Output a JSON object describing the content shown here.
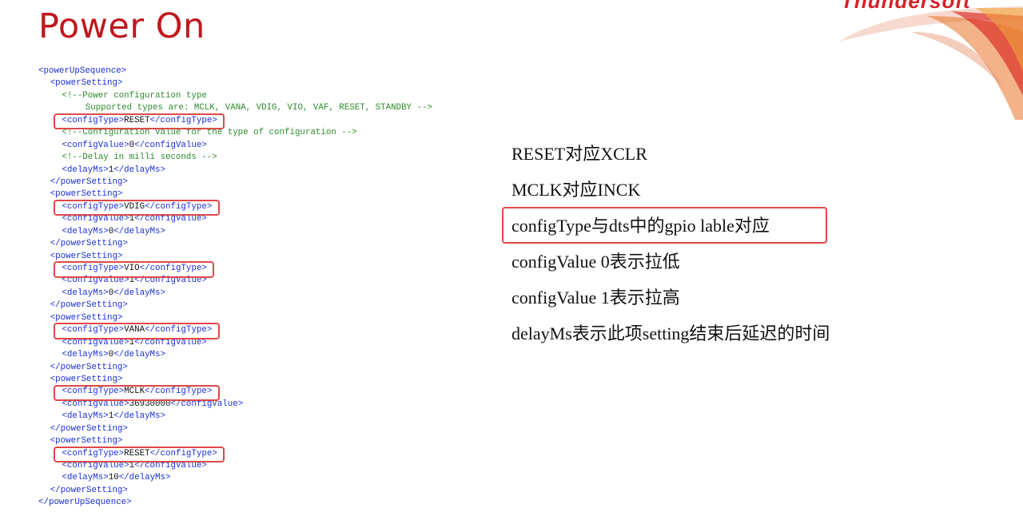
{
  "slide": {
    "title": "Power On",
    "logo_text": "Thundersoft"
  },
  "code_lines": [
    {
      "indent": 0,
      "parts": [
        {
          "t": "tag",
          "v": "<powerUpSequence>"
        }
      ]
    },
    {
      "indent": 1,
      "parts": [
        {
          "t": "tag",
          "v": "<powerSetting>"
        }
      ]
    },
    {
      "indent": 2,
      "parts": [
        {
          "t": "cmt",
          "v": "<!--Power configuration type"
        }
      ]
    },
    {
      "indent": 4,
      "parts": [
        {
          "t": "cmt",
          "v": "Supported types are: MCLK, VANA, VDIG, VIO, VAF, RESET, STANDBY -->"
        }
      ]
    },
    {
      "indent": 2,
      "hl": true,
      "parts": [
        {
          "t": "tag",
          "v": "<configType>"
        },
        {
          "t": "val",
          "v": "RESET"
        },
        {
          "t": "tag",
          "v": "</configType>"
        }
      ]
    },
    {
      "indent": 2,
      "parts": [
        {
          "t": "cmt",
          "v": "<!--Configuration value for the type of configuration -->"
        }
      ]
    },
    {
      "indent": 2,
      "parts": [
        {
          "t": "tag",
          "v": "<configValue>"
        },
        {
          "t": "val",
          "v": "0"
        },
        {
          "t": "tag",
          "v": "</configValue>"
        }
      ]
    },
    {
      "indent": 2,
      "parts": [
        {
          "t": "cmt",
          "v": "<!--Delay in milli seconds -->"
        }
      ]
    },
    {
      "indent": 2,
      "parts": [
        {
          "t": "tag",
          "v": "<delayMs>"
        },
        {
          "t": "val",
          "v": "1"
        },
        {
          "t": "tag",
          "v": "</delayMs>"
        }
      ]
    },
    {
      "indent": 1,
      "parts": [
        {
          "t": "tag",
          "v": "</powerSetting>"
        }
      ]
    },
    {
      "indent": 1,
      "parts": [
        {
          "t": "tag",
          "v": "<powerSetting>"
        }
      ]
    },
    {
      "indent": 2,
      "hl": true,
      "parts": [
        {
          "t": "tag",
          "v": "<configType>"
        },
        {
          "t": "val",
          "v": "VDIG"
        },
        {
          "t": "tag",
          "v": "</configType>"
        }
      ]
    },
    {
      "indent": 2,
      "parts": [
        {
          "t": "tag",
          "v": "<configValue>"
        },
        {
          "t": "val",
          "v": "1"
        },
        {
          "t": "tag",
          "v": "</configValue>"
        }
      ]
    },
    {
      "indent": 2,
      "parts": [
        {
          "t": "tag",
          "v": "<delayMs>"
        },
        {
          "t": "val",
          "v": "0"
        },
        {
          "t": "tag",
          "v": "</delayMs>"
        }
      ]
    },
    {
      "indent": 1,
      "parts": [
        {
          "t": "tag",
          "v": "</powerSetting>"
        }
      ]
    },
    {
      "indent": 1,
      "parts": [
        {
          "t": "tag",
          "v": "<powerSetting>"
        }
      ]
    },
    {
      "indent": 2,
      "hl": true,
      "parts": [
        {
          "t": "tag",
          "v": "<configType>"
        },
        {
          "t": "val",
          "v": "VIO"
        },
        {
          "t": "tag",
          "v": "</configType>"
        }
      ]
    },
    {
      "indent": 2,
      "parts": [
        {
          "t": "tag",
          "v": "<configValue>"
        },
        {
          "t": "val",
          "v": "1"
        },
        {
          "t": "tag",
          "v": "</configValue>"
        }
      ]
    },
    {
      "indent": 2,
      "parts": [
        {
          "t": "tag",
          "v": "<delayMs>"
        },
        {
          "t": "val",
          "v": "0"
        },
        {
          "t": "tag",
          "v": "</delayMs>"
        }
      ]
    },
    {
      "indent": 1,
      "parts": [
        {
          "t": "tag",
          "v": "</powerSetting>"
        }
      ]
    },
    {
      "indent": 1,
      "parts": [
        {
          "t": "tag",
          "v": "<powerSetting>"
        }
      ]
    },
    {
      "indent": 2,
      "hl": true,
      "parts": [
        {
          "t": "tag",
          "v": "<configType>"
        },
        {
          "t": "val",
          "v": "VANA"
        },
        {
          "t": "tag",
          "v": "</configType>"
        }
      ]
    },
    {
      "indent": 2,
      "parts": [
        {
          "t": "tag",
          "v": "<configValue>"
        },
        {
          "t": "val",
          "v": "1"
        },
        {
          "t": "tag",
          "v": "</configValue>"
        }
      ]
    },
    {
      "indent": 2,
      "parts": [
        {
          "t": "tag",
          "v": "<delayMs>"
        },
        {
          "t": "val",
          "v": "0"
        },
        {
          "t": "tag",
          "v": "</delayMs>"
        }
      ]
    },
    {
      "indent": 1,
      "parts": [
        {
          "t": "tag",
          "v": "</powerSetting>"
        }
      ]
    },
    {
      "indent": 1,
      "parts": [
        {
          "t": "tag",
          "v": "<powerSetting>"
        }
      ]
    },
    {
      "indent": 2,
      "hl": true,
      "parts": [
        {
          "t": "tag",
          "v": "<configType>"
        },
        {
          "t": "val",
          "v": "MCLK"
        },
        {
          "t": "tag",
          "v": "</configType>"
        }
      ]
    },
    {
      "indent": 2,
      "parts": [
        {
          "t": "tag",
          "v": "<configValue>"
        },
        {
          "t": "val",
          "v": "36930000"
        },
        {
          "t": "tag",
          "v": "</configValue>"
        }
      ]
    },
    {
      "indent": 2,
      "parts": [
        {
          "t": "tag",
          "v": "<delayMs>"
        },
        {
          "t": "val",
          "v": "1"
        },
        {
          "t": "tag",
          "v": "</delayMs>"
        }
      ]
    },
    {
      "indent": 1,
      "parts": [
        {
          "t": "tag",
          "v": "</powerSetting>"
        }
      ]
    },
    {
      "indent": 1,
      "parts": [
        {
          "t": "tag",
          "v": "<powerSetting>"
        }
      ]
    },
    {
      "indent": 2,
      "hl": true,
      "parts": [
        {
          "t": "tag",
          "v": "<configType>"
        },
        {
          "t": "val",
          "v": "RESET"
        },
        {
          "t": "tag",
          "v": "</configType>"
        }
      ]
    },
    {
      "indent": 2,
      "parts": [
        {
          "t": "tag",
          "v": "<configValue>"
        },
        {
          "t": "val",
          "v": "1"
        },
        {
          "t": "tag",
          "v": "</configValue>"
        }
      ]
    },
    {
      "indent": 2,
      "parts": [
        {
          "t": "tag",
          "v": "<delayMs>"
        },
        {
          "t": "val",
          "v": "10"
        },
        {
          "t": "tag",
          "v": "</delayMs>"
        }
      ]
    },
    {
      "indent": 1,
      "parts": [
        {
          "t": "tag",
          "v": "</powerSetting>"
        }
      ]
    },
    {
      "indent": 0,
      "parts": [
        {
          "t": "tag",
          "v": "</powerUpSequence>"
        }
      ]
    }
  ],
  "notes": [
    {
      "text": "RESET对应XCLR"
    },
    {
      "text": "MCLK对应INCK"
    },
    {
      "text": "configType与dts中的gpio lable对应",
      "highlighted": true
    },
    {
      "text": "configValue 0表示拉低"
    },
    {
      "text": "configValue 1表示拉高"
    },
    {
      "text": "delayMs表示此项setting结束后延迟的时间"
    }
  ],
  "colors": {
    "title": "#c0171c",
    "xml_tag": "#1a2fd6",
    "xml_comment": "#2e8a2e",
    "xml_value": "#111111",
    "highlight_box": "#e04848"
  }
}
